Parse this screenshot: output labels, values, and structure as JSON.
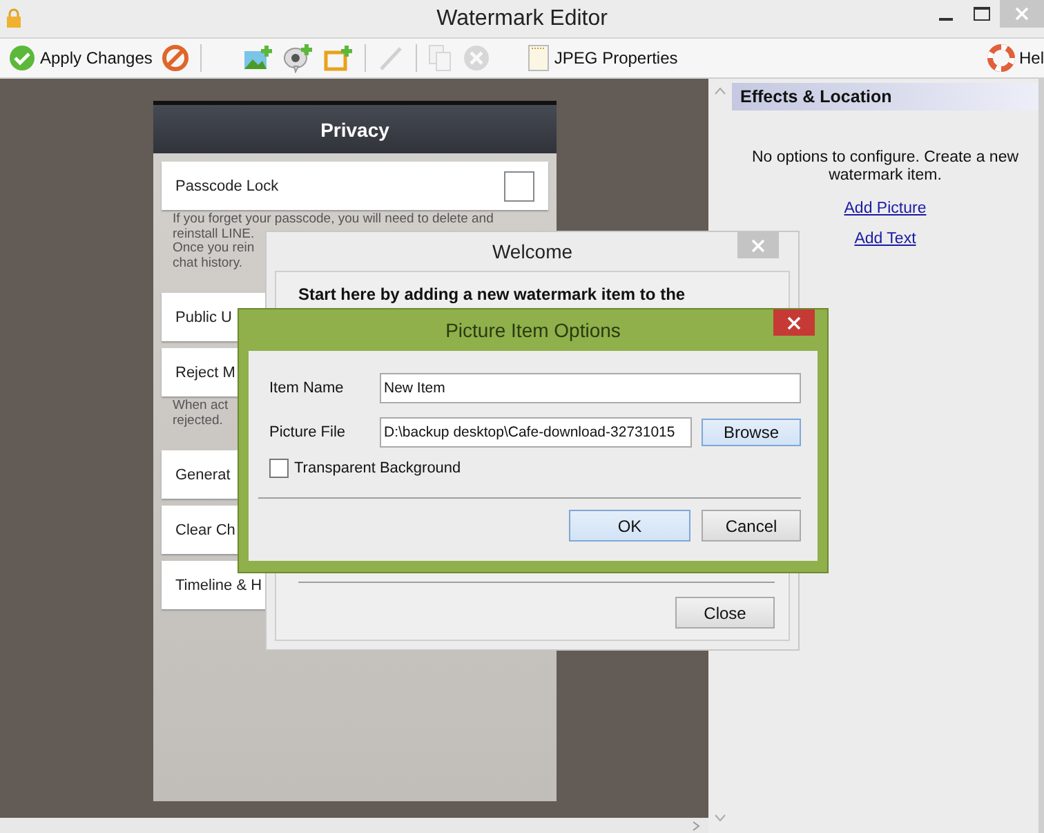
{
  "window": {
    "title": "Watermark Editor"
  },
  "toolbar": [
    {
      "kind": "button",
      "label": "Apply Changes",
      "disabled": false
    },
    {
      "kind": "icon",
      "disabled": false
    },
    {
      "kind": "separator"
    },
    {
      "kind": "icon",
      "disabled": false
    },
    {
      "kind": "icon",
      "disabled": false
    },
    {
      "kind": "icon",
      "disabled": false
    },
    {
      "kind": "separator"
    },
    {
      "kind": "icon",
      "disabled": true
    },
    {
      "kind": "separator"
    },
    {
      "kind": "icon",
      "disabled": true
    },
    {
      "kind": "icon",
      "disabled": true
    },
    {
      "kind": "button",
      "label": "JPEG Properties",
      "disabled": false
    }
  ],
  "help": {
    "label": "Hel"
  },
  "phone": {
    "title": "Privacy",
    "rows": [
      {
        "kind": "toggle",
        "label": "Passcode Lock",
        "checked": false
      },
      {
        "kind": "note",
        "lines": [
          "If you forget your passcode, you will need to delete and",
          "reinstall LINE.",
          "Once you rein",
          "chat history."
        ]
      },
      {
        "kind": "item",
        "label": "Public U"
      },
      {
        "kind": "item",
        "label": "Reject M"
      },
      {
        "kind": "note",
        "lines": [
          "When act",
          "rejected."
        ]
      },
      {
        "kind": "item",
        "label": "Generat"
      },
      {
        "kind": "item",
        "label": "Clear Ch"
      },
      {
        "kind": "item",
        "label": "Timeline & H"
      }
    ]
  },
  "panel": {
    "title": "Effects & Location",
    "message": "No options to configure. Create a new watermark item.",
    "links": [
      "Add Picture",
      "Add Text"
    ]
  },
  "welcome": {
    "title": "Welcome",
    "intro": "Start here by adding a new watermark item to the",
    "button": "Close"
  },
  "picture_dialog": {
    "title": "Picture Item Options",
    "fields": [
      {
        "label": "Item Name",
        "value": "New Item"
      },
      {
        "label": "Picture File",
        "value": "D:\\backup desktop\\Cafe-download-32731015",
        "button": "Browse"
      }
    ],
    "checkbox": {
      "label": "Transparent Background",
      "checked": false
    },
    "buttons": [
      {
        "label": "OK",
        "default": true
      },
      {
        "label": "Cancel",
        "default": false
      }
    ]
  }
}
